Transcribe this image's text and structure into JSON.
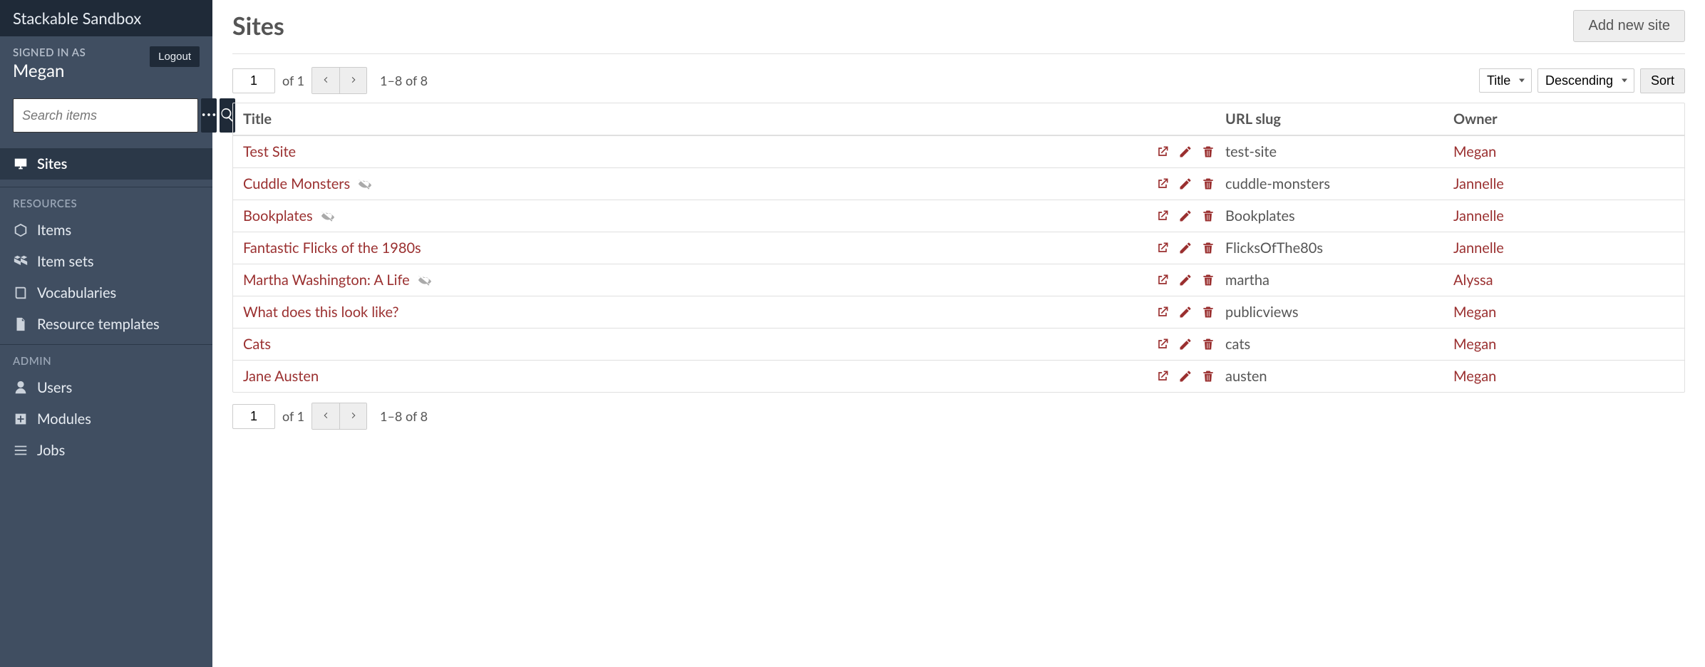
{
  "brand": "Stackable Sandbox",
  "auth": {
    "signed_in_as_label": "SIGNED IN AS",
    "user": "Megan",
    "logout_label": "Logout"
  },
  "search": {
    "placeholder": "Search items"
  },
  "nav": {
    "sites_label": "Sites",
    "resources_heading": "RESOURCES",
    "items_label": "Items",
    "item_sets_label": "Item sets",
    "vocabularies_label": "Vocabularies",
    "resource_templates_label": "Resource templates",
    "admin_heading": "ADMIN",
    "users_label": "Users",
    "modules_label": "Modules",
    "jobs_label": "Jobs"
  },
  "page": {
    "title": "Sites",
    "add_button": "Add new site"
  },
  "pagination": {
    "page_value": "1",
    "of_text": "of 1",
    "range_text": "1–8 of 8"
  },
  "sorting": {
    "sort_by_selected": "Title",
    "sort_dir_selected": "Descending",
    "sort_button": "Sort"
  },
  "table": {
    "headers": {
      "title": "Title",
      "slug": "URL slug",
      "owner": "Owner"
    },
    "rows": [
      {
        "title": "Test Site",
        "hidden": false,
        "slug": "test-site",
        "owner": "Megan"
      },
      {
        "title": "Cuddle Monsters",
        "hidden": true,
        "slug": "cuddle-monsters",
        "owner": "Jannelle"
      },
      {
        "title": "Bookplates",
        "hidden": true,
        "slug": "Bookplates",
        "owner": "Jannelle"
      },
      {
        "title": "Fantastic Flicks of the 1980s",
        "hidden": false,
        "slug": "FlicksOfThe80s",
        "owner": "Jannelle"
      },
      {
        "title": "Martha Washington: A Life",
        "hidden": true,
        "slug": "martha",
        "owner": "Alyssa"
      },
      {
        "title": "What does this look like?",
        "hidden": false,
        "slug": "publicviews",
        "owner": "Megan"
      },
      {
        "title": "Cats",
        "hidden": false,
        "slug": "cats",
        "owner": "Megan"
      },
      {
        "title": "Jane Austen",
        "hidden": false,
        "slug": "austen",
        "owner": "Megan"
      }
    ]
  },
  "colors": {
    "accent": "#9a2f2f",
    "sidebar_bg": "#404e61",
    "sidebar_dark": "#1f2a38"
  }
}
